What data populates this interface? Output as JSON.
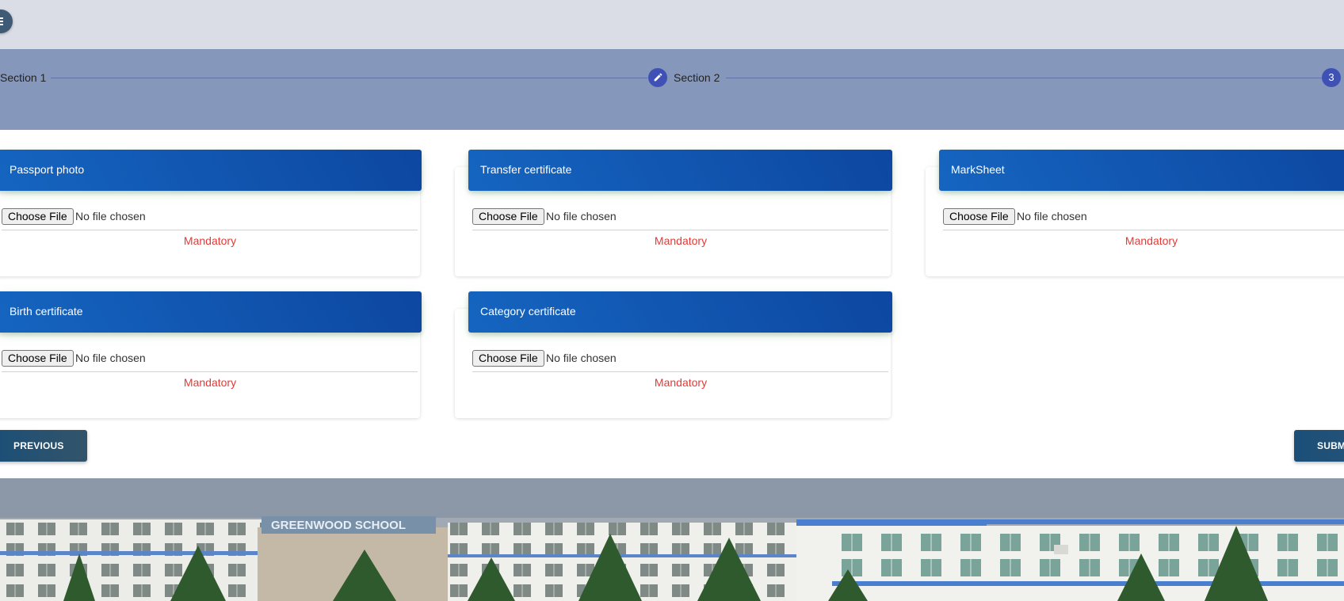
{
  "stepper": {
    "steps": [
      {
        "label": "Section 1"
      },
      {
        "label": "Section 2",
        "icon": "pencil-icon"
      },
      {
        "number": "3"
      }
    ]
  },
  "documents": [
    {
      "title": "Passport photo",
      "button": "Choose File",
      "status": "No file chosen",
      "note": "Mandatory"
    },
    {
      "title": "Transfer certificate",
      "button": "Choose File",
      "status": "No file chosen",
      "note": "Mandatory"
    },
    {
      "title": "MarkSheet",
      "button": "Choose File",
      "status": "No file chosen",
      "note": "Mandatory"
    },
    {
      "title": "Birth certificate",
      "button": "Choose File",
      "status": "No file chosen",
      "note": "Mandatory"
    },
    {
      "title": "Category certificate",
      "button": "Choose File",
      "status": "No file chosen",
      "note": "Mandatory"
    }
  ],
  "actions": {
    "previous": "PREVIOUS",
    "submit": "SUBMIT"
  },
  "banner": {
    "sign_text": "GREENWOOD SCHOOL"
  },
  "colors": {
    "card_header": "#1565c0",
    "mandatory": "#e53935",
    "step_active": "#3f51b5",
    "button": "#1b4f77"
  }
}
